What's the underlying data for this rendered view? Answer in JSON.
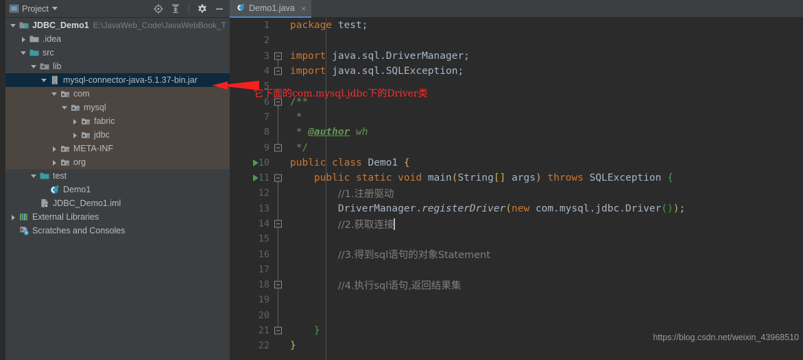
{
  "window": {
    "panel_title": "Project",
    "panel_icons": [
      "locate-icon",
      "collapse-all-icon",
      "settings-gear-icon",
      "minimize-icon"
    ]
  },
  "colors": {
    "editor_bg": "#2b2b2b",
    "panel_bg": "#3c3f41",
    "selection_blue": "#0d293e",
    "jar_brown": "#4d4640",
    "tab_underline": "#4a88c7",
    "keyword_orange": "#cc7832",
    "comment_gray": "#808080",
    "javadoc_green": "#629755",
    "plain_text": "#a9b7c6",
    "line_number": "#606366",
    "annotation_red": "#ff2d2d",
    "run_green": "#499c54"
  },
  "tree": [
    {
      "indent": 0,
      "arrow": "down",
      "icon": "project-folder-icon",
      "label": "JDBC_Demo1",
      "bold": true,
      "sub": "E:\\JavaWeb_Code\\JavaWebBook_T",
      "state": "normal"
    },
    {
      "indent": 1,
      "arrow": "right",
      "icon": "folder-icon",
      "label": ".idea",
      "bold": false,
      "sub": "",
      "state": "normal"
    },
    {
      "indent": 1,
      "arrow": "down",
      "icon": "source-folder-icon",
      "label": "src",
      "bold": false,
      "sub": "",
      "state": "normal"
    },
    {
      "indent": 2,
      "arrow": "down",
      "icon": "lib-folder-icon",
      "label": "lib",
      "bold": false,
      "sub": "",
      "state": "normal"
    },
    {
      "indent": 3,
      "arrow": "down",
      "icon": "jar-icon",
      "label": "mysql-connector-java-5.1.37-bin.jar",
      "bold": false,
      "sub": "",
      "state": "selected"
    },
    {
      "indent": 4,
      "arrow": "down",
      "icon": "package-icon",
      "label": "com",
      "bold": false,
      "sub": "",
      "state": "jar"
    },
    {
      "indent": 5,
      "arrow": "down",
      "icon": "package-icon",
      "label": "mysql",
      "bold": false,
      "sub": "",
      "state": "jar"
    },
    {
      "indent": 6,
      "arrow": "right",
      "icon": "package-icon",
      "label": "fabric",
      "bold": false,
      "sub": "",
      "state": "jar"
    },
    {
      "indent": 6,
      "arrow": "right",
      "icon": "package-icon",
      "label": "jdbc",
      "bold": false,
      "sub": "",
      "state": "jar"
    },
    {
      "indent": 4,
      "arrow": "right",
      "icon": "package-icon",
      "label": "META-INF",
      "bold": false,
      "sub": "",
      "state": "jar"
    },
    {
      "indent": 4,
      "arrow": "right",
      "icon": "package-icon",
      "label": "org",
      "bold": false,
      "sub": "",
      "state": "jar"
    },
    {
      "indent": 2,
      "arrow": "down",
      "icon": "source-folder-icon",
      "label": "test",
      "bold": false,
      "sub": "",
      "state": "normal"
    },
    {
      "indent": 3,
      "arrow": "none",
      "icon": "java-class-icon",
      "label": "Demo1",
      "bold": false,
      "sub": "",
      "state": "normal"
    },
    {
      "indent": 2,
      "arrow": "none",
      "icon": "iml-file-icon",
      "label": "JDBC_Demo1.iml",
      "bold": false,
      "sub": "",
      "state": "normal"
    },
    {
      "indent": 0,
      "arrow": "right",
      "icon": "external-libraries-icon",
      "label": "External Libraries",
      "bold": false,
      "sub": "",
      "state": "normal"
    },
    {
      "indent": 0,
      "arrow": "none",
      "icon": "scratches-icon",
      "label": "Scratches and Consoles",
      "bold": false,
      "sub": "",
      "state": "normal"
    }
  ],
  "editor": {
    "tab_label": "Demo1.java",
    "tab_icon": "java-class-icon",
    "tab_close": "×",
    "watermark": "https://blog.csdn.net/weixin_43968510",
    "annotation": "它下面的com.mysql.jdbc下的Driver类",
    "lines": [
      {
        "n": "1",
        "run": false,
        "fold": "none"
      },
      {
        "n": "2",
        "run": false,
        "fold": "none"
      },
      {
        "n": "3",
        "run": false,
        "fold": "open"
      },
      {
        "n": "4",
        "run": false,
        "fold": "end"
      },
      {
        "n": "5",
        "run": false,
        "fold": "none"
      },
      {
        "n": "6",
        "run": false,
        "fold": "open"
      },
      {
        "n": "7",
        "run": false,
        "fold": "bar"
      },
      {
        "n": "8",
        "run": false,
        "fold": "bar"
      },
      {
        "n": "9",
        "run": false,
        "fold": "end"
      },
      {
        "n": "10",
        "run": true,
        "fold": "none"
      },
      {
        "n": "11",
        "run": true,
        "fold": "open"
      },
      {
        "n": "12",
        "run": false,
        "fold": "bar"
      },
      {
        "n": "13",
        "run": false,
        "fold": "bar"
      },
      {
        "n": "14",
        "run": false,
        "fold": "end2"
      },
      {
        "n": "15",
        "run": false,
        "fold": "bar"
      },
      {
        "n": "16",
        "run": false,
        "fold": "bar"
      },
      {
        "n": "17",
        "run": false,
        "fold": "bar"
      },
      {
        "n": "18",
        "run": false,
        "fold": "end2"
      },
      {
        "n": "19",
        "run": false,
        "fold": "bar"
      },
      {
        "n": "20",
        "run": false,
        "fold": "bar"
      },
      {
        "n": "21",
        "run": false,
        "fold": "end"
      },
      {
        "n": "22",
        "run": false,
        "fold": "none"
      }
    ],
    "code": {
      "l1": "package test;",
      "l3": "import java.sql.DriverManager;",
      "l4": "import java.sql.SQLException;",
      "l6": "/**",
      "l7": "*",
      "l8_star": "*",
      "l8_tag": "@author",
      "l8_txt": "wh",
      "l9": "*/",
      "l10": "public class Demo1 {",
      "l11": "public static void main(String[] args) throws SQLException {",
      "l12": "//1.注册驱动",
      "l13": "DriverManager.registerDriver(new com.mysql.jdbc.Driver());",
      "l14": "//2.获取连接",
      "l16": "//3.得到sql语句的对象Statement",
      "l18": "//4.执行sql语句,返回结果集",
      "l21": "}",
      "l22": "}"
    }
  }
}
